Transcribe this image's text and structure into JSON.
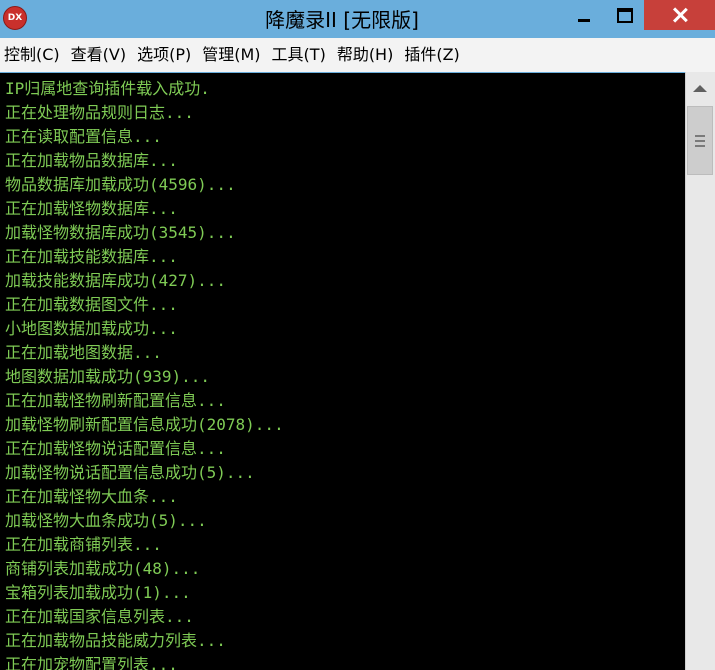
{
  "window": {
    "title": "降魔录II [无限版]",
    "icon_label": "DX"
  },
  "menu": {
    "items": [
      {
        "label": "控制(C)"
      },
      {
        "label": "查看(V)"
      },
      {
        "label": "选项(P)"
      },
      {
        "label": "管理(M)"
      },
      {
        "label": "工具(T)"
      },
      {
        "label": "帮助(H)"
      },
      {
        "label": "插件(Z)"
      }
    ]
  },
  "console": {
    "lines": [
      "IP归属地查询插件载入成功.",
      "正在处理物品规则日志...",
      "正在读取配置信息...",
      "正在加载物品数据库...",
      "物品数据库加载成功(4596)...",
      "正在加载怪物数据库...",
      "加载怪物数据库成功(3545)...",
      "正在加载技能数据库...",
      "加载技能数据库成功(427)...",
      "正在加载数据图文件...",
      "小地图数据加载成功...",
      "正在加载地图数据...",
      "地图数据加载成功(939)...",
      "正在加载怪物刷新配置信息...",
      "加载怪物刷新配置信息成功(2078)...",
      "正在加载怪物说话配置信息...",
      "加载怪物说话配置信息成功(5)...",
      "正在加载怪物大血条...",
      "加载怪物大血条成功(5)...",
      "正在加载商铺列表...",
      "商铺列表加载成功(48)...",
      "宝箱列表加载成功(1)...",
      "正在加载国家信息列表...",
      "正在加载物品技能威力列表...",
      "正在加宠物配置列表..."
    ]
  },
  "colors": {
    "titlebar": "#6aaedc",
    "close_button": "#c7403a",
    "console_bg": "#000000",
    "console_text": "#7fcb55",
    "menubar_bg": "#f3f3f3"
  }
}
